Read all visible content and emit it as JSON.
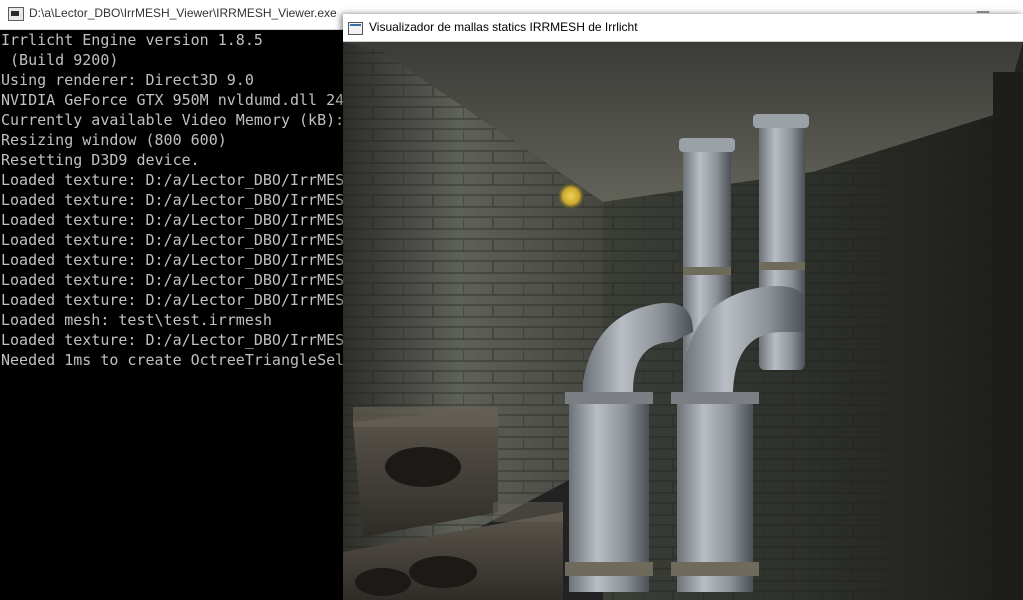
{
  "console_window": {
    "title": "D:\\a\\Lector_DBO\\IrrMESH_Viewer\\IRRMESH_Viewer.exe",
    "minimize_glyph": "—",
    "lines": [
      "Irrlicht Engine version 1.8.5",
      " (Build 9200)",
      "Using renderer: Direct3D 9.0",
      "NVIDIA GeForce GTX 950M nvldumd.dll 24",
      "Currently available Video Memory (kB):",
      "Resizing window (800 600)",
      "Resetting D3D9 device.",
      "Loaded texture: D:/a/Lector_DBO/IrrMESH",
      "Loaded texture: D:/a/Lector_DBO/IrrMESH",
      "Loaded texture: D:/a/Lector_DBO/IrrMESH",
      "Loaded texture: D:/a/Lector_DBO/IrrMESH",
      "Loaded texture: D:/a/Lector_DBO/IrrMESH",
      "Loaded texture: D:/a/Lector_DBO/IrrMESH",
      "Loaded texture: D:/a/Lector_DBO/IrrMESH",
      "Loaded mesh: test\\test.irrmesh",
      "Loaded texture: D:/a/Lector_DBO/IrrMESH",
      "Needed 1ms to create OctreeTriangleSele"
    ]
  },
  "viewer_window": {
    "title": "Visualizador de mallas statics IRRMESH de Irrlicht"
  },
  "colors": {
    "console_text": "#c0c0c0",
    "console_bg": "#000000"
  }
}
